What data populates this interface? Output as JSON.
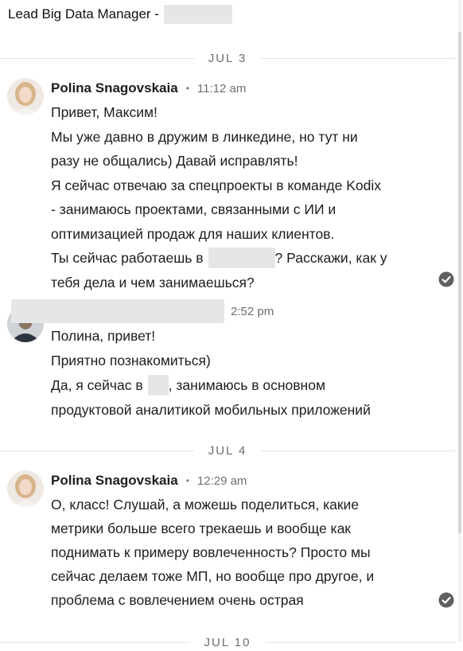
{
  "header": {
    "title": "Lead Big Data Manager -"
  },
  "dates": {
    "jul3": "JUL 3",
    "jul4": "JUL 4",
    "jul10": "JUL 10"
  },
  "messages": [
    {
      "sender": "Polina Snagovskaia",
      "time": "11:12 am",
      "lines": [
        "Привет, Максим!",
        "Мы уже давно в дружим в линкедине, но тут ни",
        "разу не общались) Давай исправлять!",
        "Я сейчас отвечаю за спецпроекты в команде Kodix",
        "- занимаюсь проектами, связанными с ИИ и",
        "оптимизацией продаж для наших клиентов.",
        "Ты сейчас работаешь в",
        "? Расскажи, как у",
        "тебя дела и чем занимаешься?"
      ],
      "status_icon": "check-circle-icon"
    },
    {
      "sender": "",
      "time": "2:52 pm",
      "lines": [
        "Полина, привет!",
        "Приятно познакомиться)",
        "Да, я сейчас в",
        ", занимаюсь в основном",
        "продуктовой аналитикой мобильных приложений"
      ]
    },
    {
      "sender": "Polina Snagovskaia",
      "time": "12:29 am",
      "lines": [
        "О, класс! Слушай, а можешь поделиться, какие",
        "метрики больше всего трекаешь и вообще как",
        "поднимать к примеру вовлеченность? Просто мы",
        "сейчас делаем тоже МП, но вообще про другое, и",
        "проблема с вовлечением очень острая"
      ],
      "status_icon": "check-circle-icon"
    }
  ],
  "colors": {
    "text": "#1d1d1f",
    "muted": "#6f6f6f",
    "redaction": "#e6e6e6",
    "check": "#5f5f5f"
  }
}
